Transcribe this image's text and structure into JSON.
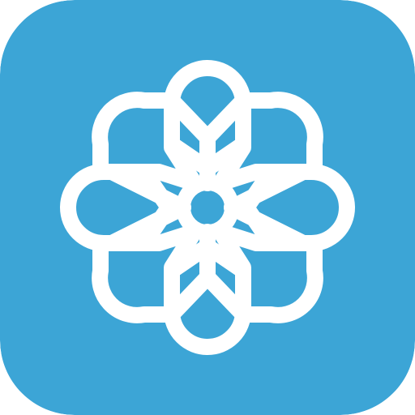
{
  "app_icon": {
    "icon_name": "flower-mandala-icon",
    "background_color": "#3CA5D6",
    "foreground_color": "#FFFFFF"
  }
}
